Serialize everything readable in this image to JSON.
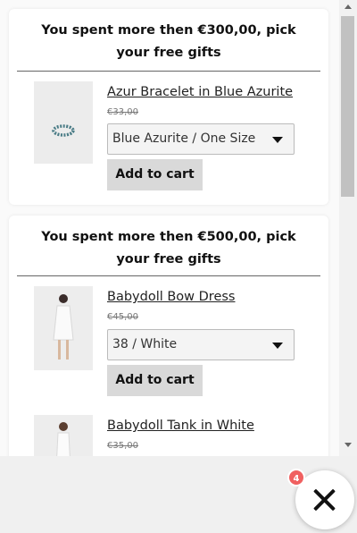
{
  "offers": [
    {
      "title": "You spent more then €300,00, pick your free gifts",
      "products": [
        {
          "name": "Azur Bracelet in Blue Azurite",
          "price": "€33,00",
          "variant": "Blue Azurite / One Size",
          "button": "Add to cart",
          "image": "bracelet-image"
        }
      ]
    },
    {
      "title": "You spent more then €500,00, pick your free gifts",
      "products": [
        {
          "name": "Babydoll Bow Dress",
          "price": "€45,00",
          "variant": "38 / White",
          "button": "Add to cart",
          "image": "dress-image"
        },
        {
          "name": "Babydoll Tank in White",
          "price": "€35,00",
          "image": "tank-image"
        }
      ]
    }
  ],
  "close_badge": {
    "count": "4"
  },
  "colors": {
    "badge": "#f06060",
    "button_bg": "#d9d9d9"
  }
}
